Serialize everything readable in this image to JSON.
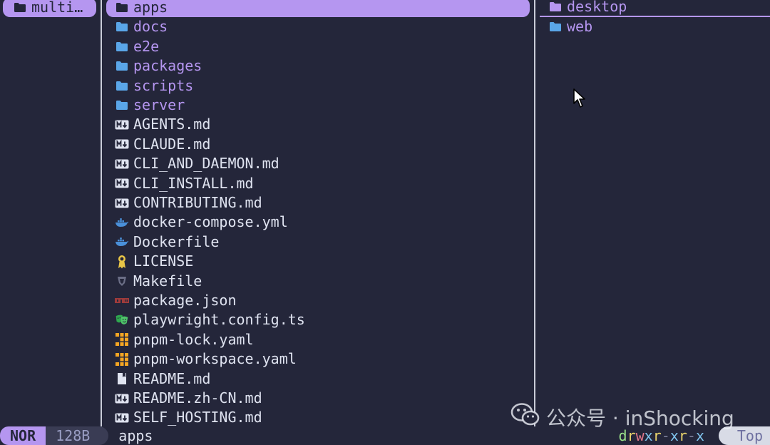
{
  "parent_pane": {
    "items": [
      {
        "label": "multi…",
        "icon": "folder-icon",
        "selected": true
      }
    ]
  },
  "current_pane": {
    "items": [
      {
        "label": "apps",
        "type": "dir",
        "icon": "folder-icon",
        "selected": true
      },
      {
        "label": "docs",
        "type": "dir",
        "icon": "folder-icon"
      },
      {
        "label": "e2e",
        "type": "dir",
        "icon": "folder-icon"
      },
      {
        "label": "packages",
        "type": "dir",
        "icon": "folder-icon"
      },
      {
        "label": "scripts",
        "type": "dir",
        "icon": "folder-icon"
      },
      {
        "label": "server",
        "type": "dir",
        "icon": "folder-icon"
      },
      {
        "label": "AGENTS.md",
        "type": "file",
        "icon": "markdown-icon"
      },
      {
        "label": "CLAUDE.md",
        "type": "file",
        "icon": "markdown-icon"
      },
      {
        "label": "CLI_AND_DAEMON.md",
        "type": "file",
        "icon": "markdown-icon"
      },
      {
        "label": "CLI_INSTALL.md",
        "type": "file",
        "icon": "markdown-icon"
      },
      {
        "label": "CONTRIBUTING.md",
        "type": "file",
        "icon": "markdown-icon"
      },
      {
        "label": "docker-compose.yml",
        "type": "file",
        "icon": "docker-icon"
      },
      {
        "label": "Dockerfile",
        "type": "file",
        "icon": "docker-icon"
      },
      {
        "label": "LICENSE",
        "type": "file",
        "icon": "license-icon"
      },
      {
        "label": "Makefile",
        "type": "file",
        "icon": "makefile-icon"
      },
      {
        "label": "package.json",
        "type": "file",
        "icon": "npm-icon"
      },
      {
        "label": "playwright.config.ts",
        "type": "file",
        "icon": "playwright-icon"
      },
      {
        "label": "pnpm-lock.yaml",
        "type": "file",
        "icon": "pnpm-icon"
      },
      {
        "label": "pnpm-workspace.yaml",
        "type": "file",
        "icon": "pnpm-icon"
      },
      {
        "label": "README.md",
        "type": "file",
        "icon": "readme-icon"
      },
      {
        "label": "README.zh-CN.md",
        "type": "file",
        "icon": "markdown-icon"
      },
      {
        "label": "SELF_HOSTING.md",
        "type": "file",
        "icon": "markdown-icon"
      }
    ]
  },
  "preview_pane": {
    "items": [
      {
        "label": "desktop",
        "type": "dir",
        "icon": "folder-icon",
        "hovered": true
      },
      {
        "label": "web",
        "type": "dir",
        "icon": "folder-icon"
      }
    ]
  },
  "status_bar": {
    "mode": "NOR",
    "size": "128B",
    "name": "apps",
    "permissions": [
      "d",
      "r",
      "w",
      "x",
      "r",
      "-",
      "x",
      "r",
      "-",
      "x"
    ],
    "position": "Top"
  },
  "watermark": {
    "text": "公众号 · inShocking",
    "icon": "wechat-icon"
  },
  "colors": {
    "background": "#24263a",
    "accent": "#b596f0",
    "folder": "#5aa6e8",
    "text": "#dfe3f0"
  }
}
